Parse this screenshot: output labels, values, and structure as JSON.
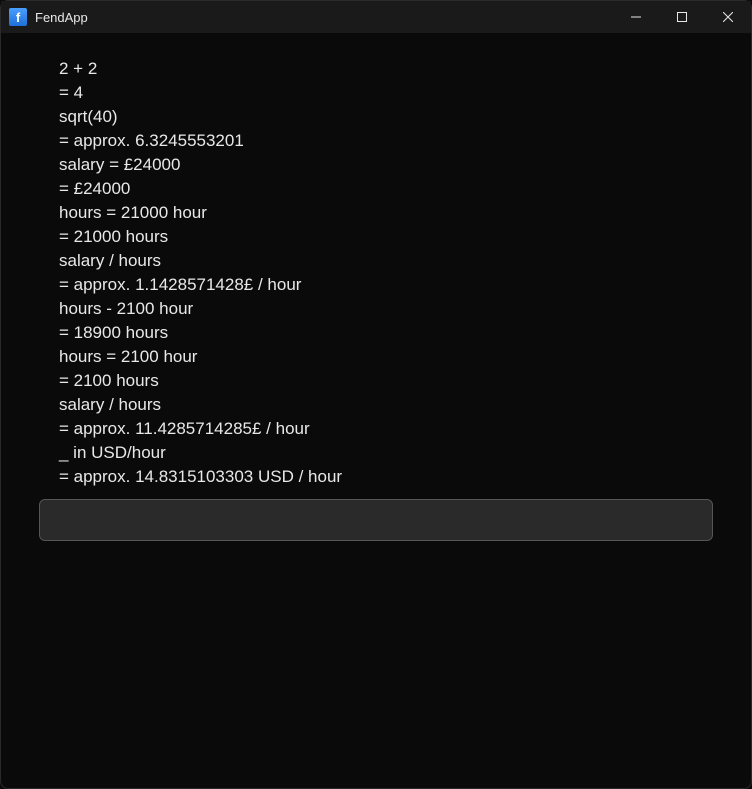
{
  "window": {
    "title": "FendApp",
    "icon_letter": "f"
  },
  "history": [
    "2 + 2",
    "= 4",
    "sqrt(40)",
    "= approx. 6.3245553201",
    "salary = £24000",
    "= £24000",
    "hours = 21000 hour",
    "= 21000 hours",
    "salary / hours",
    "= approx. 1.1428571428£ / hour",
    "hours - 2100 hour",
    "= 18900 hours",
    "hours = 2100 hour",
    "= 2100 hours",
    "salary / hours",
    "= approx. 11.4285714285£ / hour",
    "_ in USD/hour",
    "= approx. 14.8315103303 USD / hour"
  ],
  "input": {
    "value": "",
    "placeholder": ""
  }
}
